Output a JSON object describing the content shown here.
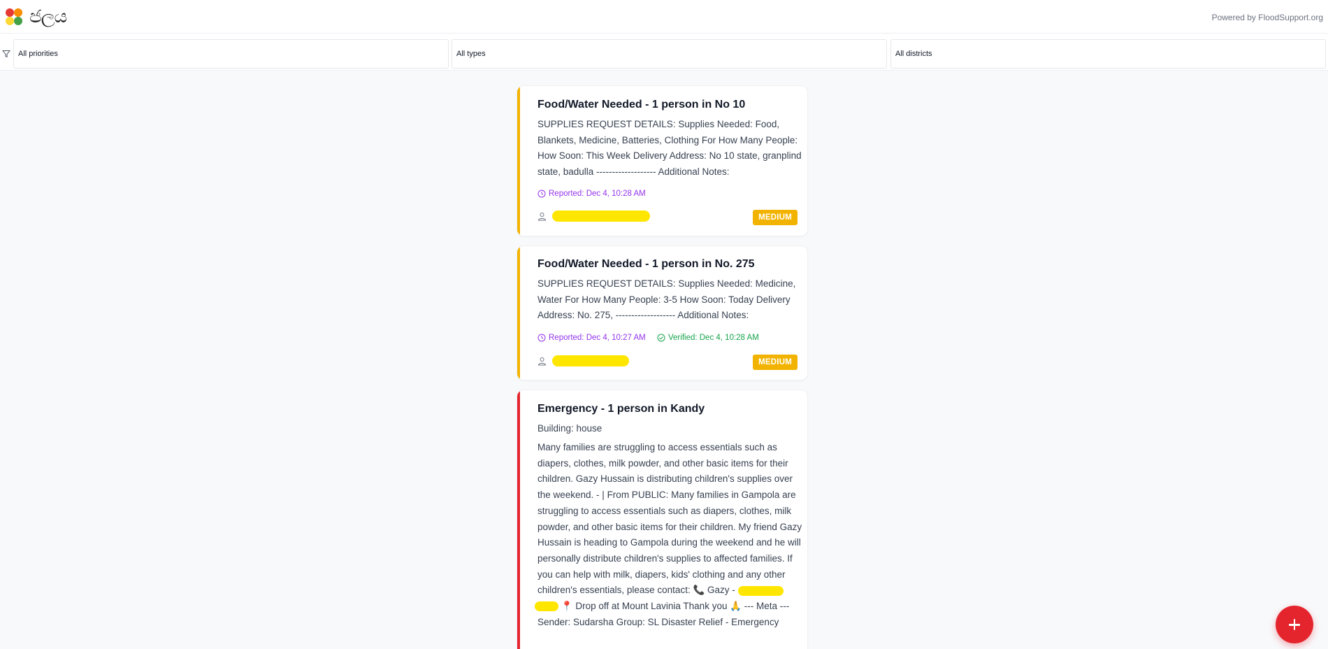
{
  "header": {
    "logo_text": "ජලය",
    "powered_by": "Powered by FloodSupport.org"
  },
  "filters": {
    "priority": "All priorities",
    "type": "All types",
    "district": "All districts"
  },
  "cards": [
    {
      "title": "Food/Water Needed - 1 person in No 10",
      "description": "SUPPLIES REQUEST DETAILS: Supplies Needed: Food, Blankets, Medicine, Batteries, Clothing For How Many People: How Soon: This Week Delivery Address: No 10 state, granplind state, badulla ------------------- Additional Notes:",
      "reported": "Reported: Dec 4, 10:28 AM",
      "priority": "MEDIUM"
    },
    {
      "title": "Food/Water Needed - 1 person in No. 275",
      "description": "SUPPLIES REQUEST DETAILS: Supplies Needed: Medicine, Water For How Many People: 3-5 How Soon: Today Delivery Address: No. 275, ------------------- Additional Notes:",
      "reported": "Reported: Dec 4, 10:27 AM",
      "verified": "Verified: Dec 4, 10:28 AM",
      "priority": "MEDIUM"
    },
    {
      "title": "Emergency - 1 person in Kandy",
      "building": "Building: house",
      "description_part1": "Many families are struggling to access essentials such as diapers, clothes, milk powder, and other basic items for their children. Gazy Hussain is distributing children's supplies over the weekend. - | From PUBLIC: Many families in Gampola are struggling to access essentials such as diapers, clothes, milk powder, and other basic items for their children. My friend Gazy Hussain is heading to Gampola during the weekend and he will personally distribute children's supplies to affected families. If you can help with milk, diapers, kids' clothing and any other children's essentials, please contact: 📞 Gazy -",
      "description_part2": "📍 Drop off at Mount Lavinia Thank you 🙏 --- Meta --- Sender: Sudarsha Group: SL Disaster Relief - Emergency"
    }
  ],
  "colors": {
    "medium": "#f2b300",
    "emergency": "#e5252e",
    "reported": "#9333ea",
    "verified": "#16a34a"
  },
  "icons": [
    "filter-icon",
    "clock-icon",
    "check-circle-icon",
    "user-icon",
    "plus-icon"
  ]
}
